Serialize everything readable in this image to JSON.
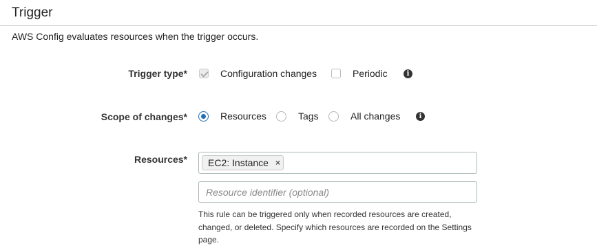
{
  "section": {
    "title": "Trigger",
    "description": "AWS Config evaluates resources when the trigger occurs."
  },
  "trigger_type": {
    "label": "Trigger type*",
    "options": [
      {
        "label": "Configuration changes",
        "checked": true,
        "disabled": true
      },
      {
        "label": "Periodic",
        "checked": false
      }
    ],
    "info_icon": "info-icon"
  },
  "scope": {
    "label": "Scope of changes*",
    "options": [
      {
        "label": "Resources",
        "selected": true
      },
      {
        "label": "Tags",
        "selected": false
      },
      {
        "label": "All changes",
        "selected": false
      }
    ],
    "info_icon": "info-icon"
  },
  "resources": {
    "label": "Resources*",
    "tokens": [
      {
        "label": "EC2: Instance",
        "remove_glyph": "×"
      }
    ],
    "identifier_placeholder": "Resource identifier (optional)",
    "help_text": "This rule can be triggered only when recorded resources are created, changed, or deleted. Specify which resources are recorded on the Settings page."
  },
  "colors": {
    "radio_selected": "#1f6fb6",
    "divider": "#c8c8c8"
  }
}
